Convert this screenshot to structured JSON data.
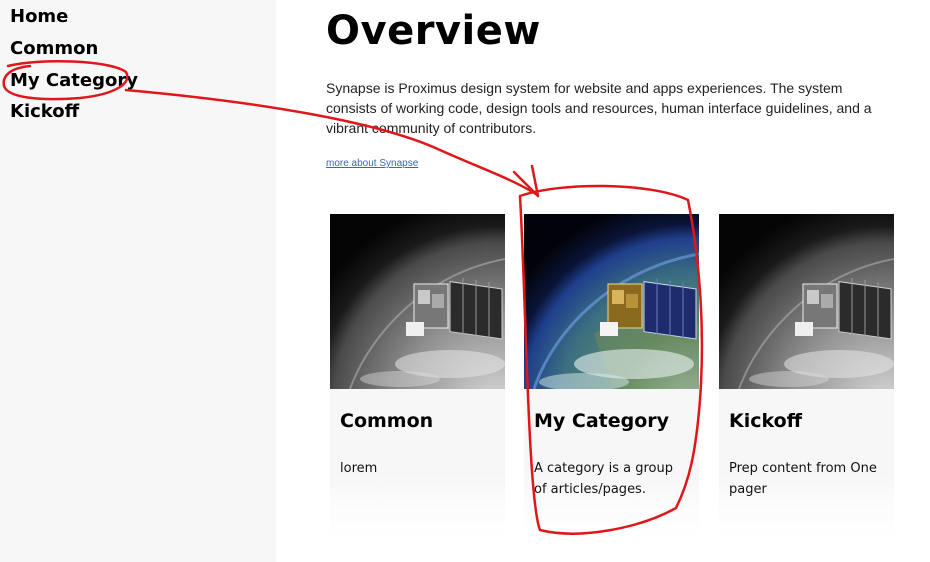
{
  "sidebar": {
    "items": [
      {
        "label": "Home"
      },
      {
        "label": "Common"
      },
      {
        "label": "My Category"
      },
      {
        "label": "Kickoff"
      }
    ]
  },
  "main": {
    "title": "Overview",
    "intro": "Synapse is Proximus design system for website and apps experiences. The system consists of working code, design tools and resources, human interface guidelines, and a vibrant community of contributors.",
    "more_link": "more about Synapse"
  },
  "cards": [
    {
      "title": "Common",
      "description": "lorem",
      "image": "satellite-earth-grayscale"
    },
    {
      "title": "My Category",
      "description": "A category is a group of articles/pages.",
      "image": "satellite-earth-color"
    },
    {
      "title": "Kickoff",
      "description": "Prep content from One pager",
      "image": "satellite-earth-grayscale"
    }
  ],
  "colors": {
    "sidebar_bg": "#f7f7f7",
    "link": "#3a66b8",
    "annotation": "#e0161a"
  }
}
